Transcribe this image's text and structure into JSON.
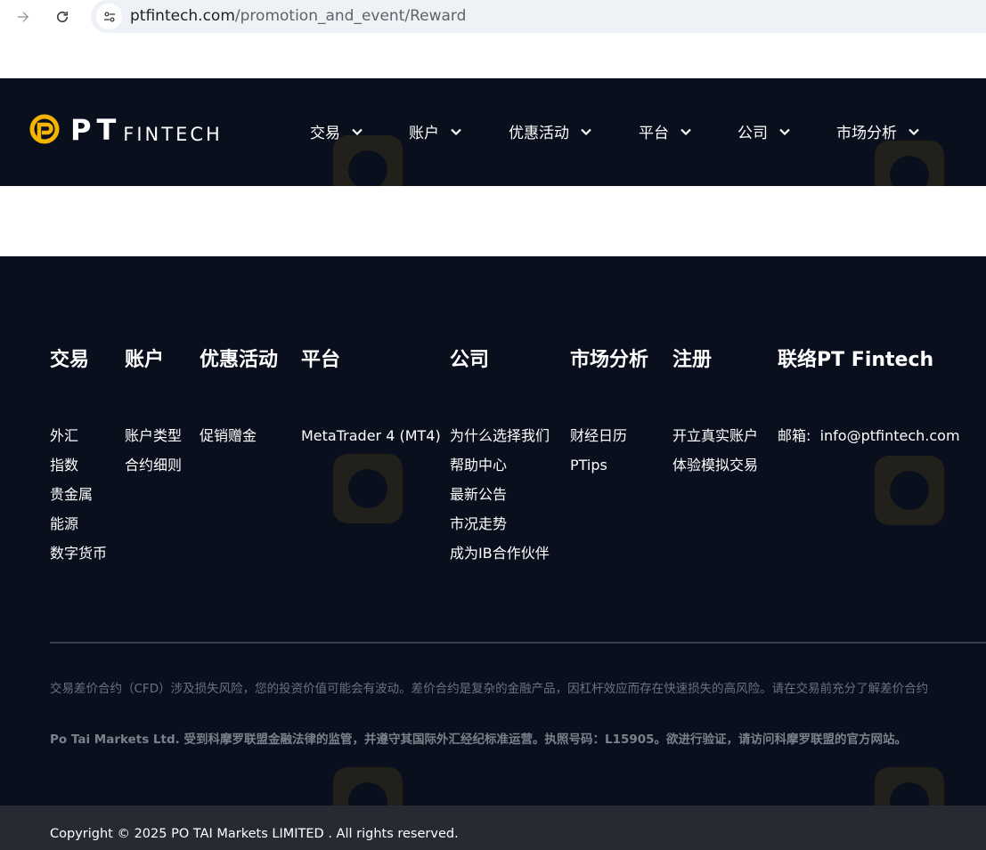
{
  "browser": {
    "url_host": "ptfintech.com",
    "url_path": "/promotion_and_event/Reward"
  },
  "header": {
    "logo_pt": "PT",
    "logo_fintech": "FINTECH",
    "nav": [
      {
        "label": "交易"
      },
      {
        "label": "账户"
      },
      {
        "label": "优惠活动"
      },
      {
        "label": "平台"
      },
      {
        "label": "公司"
      },
      {
        "label": "市场分析"
      }
    ]
  },
  "footer": {
    "columns": [
      {
        "title": "交易",
        "links": [
          "外汇",
          "指数",
          "贵金属",
          "能源",
          "数字货币"
        ]
      },
      {
        "title": "账户",
        "links": [
          "账户类型",
          "合约细则"
        ]
      },
      {
        "title": "优惠活动",
        "links": [
          "促销赠金"
        ]
      },
      {
        "title": "平台",
        "links": [
          "MetaTrader 4 (MT4)"
        ]
      },
      {
        "title": "公司",
        "links": [
          "为什么选择我们",
          "帮助中心",
          "最新公告",
          "市况走势",
          "成为IB合作伙伴"
        ]
      },
      {
        "title": "市场分析",
        "links": [
          "财经日历",
          "PTips"
        ]
      },
      {
        "title": "注册",
        "links": [
          "开立真实账户",
          "体验模拟交易"
        ]
      },
      {
        "title": "联络PT Fintech",
        "links": [
          "邮箱:  info@ptfintech.com"
        ]
      }
    ],
    "risk_text": "交易差价合约（CFD）涉及损失风险，您的投资价值可能会有波动。差价合约是复杂的金融产品，因杠杆效应而存在快速损失的高风险。请在交易前充分了解差价合约",
    "regulation_text": "Po Tai Markets Ltd. 受到科摩罗联盟金融法律的监管，并遵守其国际外汇经纪标准运营。执照号码：L15905。欲进行验证，请访问科摩罗联盟的官方网站。",
    "copyright": "Copyright © 2025 PO TAI Markets LIMITED . All rights reserved."
  },
  "colors": {
    "header_bg": "#0a0f1e",
    "accent": "#f5b400"
  }
}
